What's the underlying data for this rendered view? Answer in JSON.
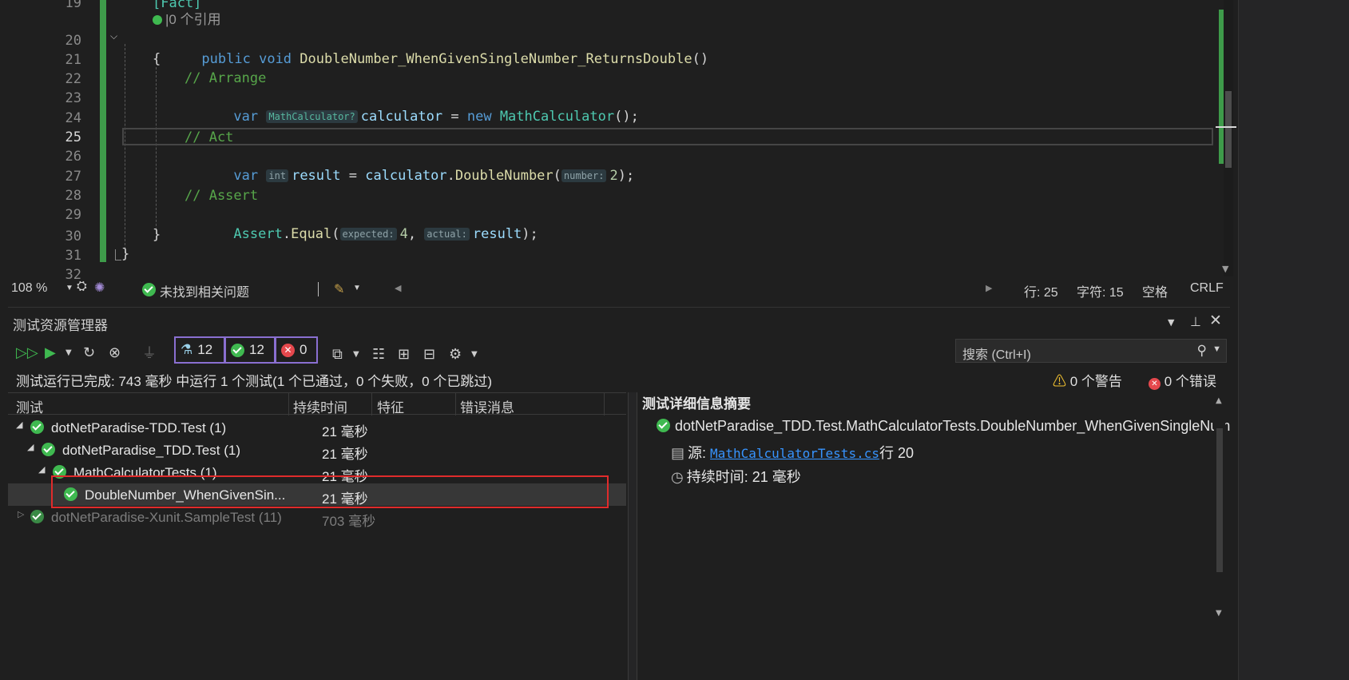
{
  "editor": {
    "line_numbers": [
      "19",
      "20",
      "21",
      "22",
      "23",
      "24",
      "25",
      "26",
      "27",
      "28",
      "29",
      "30",
      "31",
      "32"
    ],
    "current_line": "25",
    "code": {
      "attr_fact": "[Fact]",
      "lens_refs": "|0 个引用",
      "l20": {
        "kw1": "public",
        "kw2": "void",
        "name": "DoubleNumber_WhenGivenSingleNumber_ReturnsDouble",
        "parens": "()"
      },
      "l21": "{",
      "l22": "// Arrange",
      "l23": {
        "kw": "var",
        "hint": "MathCalculator?",
        "var": "calculator",
        "eq": " = ",
        "new": "new",
        "type": "MathCalculator",
        "tail": "();"
      },
      "l25": "// Act",
      "l26": {
        "kw": "var",
        "hint": "int",
        "var": "result",
        "eq": " = ",
        "obj": "calculator",
        "dot": ".",
        "method": "DoubleNumber",
        "open": "(",
        "hint2": "number:",
        "num": "2",
        "tail": ");"
      },
      "l28": "// Assert",
      "l29": {
        "cls": "Assert",
        "dot": ".",
        "method": "Equal",
        "open": "(",
        "hint1": "expected:",
        "num": "4",
        "comma": ", ",
        "hint2": "actual:",
        "var": "result",
        "tail": ");"
      },
      "l30": "}",
      "l31": "}"
    }
  },
  "statusbar": {
    "zoom": "108 %",
    "issues": "未找到相关问题",
    "line": "行: 25",
    "char": "字符: 15",
    "spaces": "空格",
    "eol": "CRLF"
  },
  "test_explorer": {
    "title": "测试资源管理器",
    "counters": {
      "total": "12",
      "passed": "12",
      "failed": "0"
    },
    "search_placeholder": "搜索 (Ctrl+I)",
    "summary": "测试运行已完成: 743 毫秒 中运行 1 个测试(1 个已通过，0 个失败，0 个已跳过)",
    "warnings": "0 个警告",
    "errors": "0 个错误",
    "columns": [
      "测试",
      "持续时间",
      "特征",
      "错误消息"
    ],
    "rows": [
      {
        "name": "dotNetParadise-TDD.Test (1)",
        "duration": "21 毫秒"
      },
      {
        "name": "dotNetParadise_TDD.Test (1)",
        "duration": "21 毫秒"
      },
      {
        "name": "MathCalculatorTests (1)",
        "duration": "21 毫秒"
      },
      {
        "name": "DoubleNumber_WhenGivenSin...",
        "duration": "21 毫秒"
      },
      {
        "name": "dotNetParadise-Xunit.SampleTest (11)",
        "duration": "703 毫秒"
      }
    ],
    "details": {
      "title": "测试详细信息摘要",
      "full_name": "dotNetParadise_TDD.Test.MathCalculatorTests.DoubleNumber_WhenGivenSingleNumber_ReturnsDouble",
      "source_label": "源:",
      "source_file": "MathCalculatorTests.cs",
      "source_line": "行 20",
      "duration_label": "持续时间: 21 毫秒"
    }
  }
}
